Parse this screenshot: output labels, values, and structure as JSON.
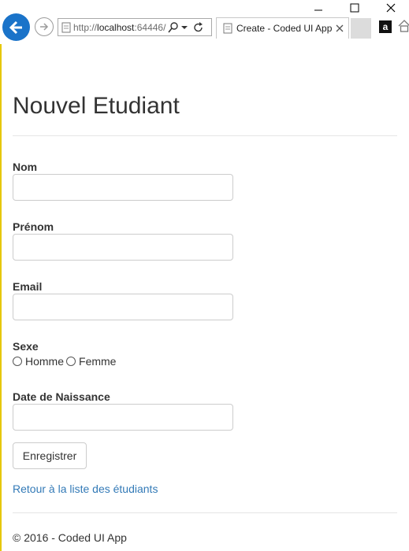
{
  "browser": {
    "url_prefix": "http://",
    "url_host": "localhost",
    "url_rest": ":64446/",
    "tab_title": "Create - Coded UI App"
  },
  "form": {
    "title": "Nouvel Etudiant",
    "nom_label": "Nom",
    "prenom_label": "Prénom",
    "email_label": "Email",
    "sexe_label": "Sexe",
    "sexe_options": [
      "Homme",
      "Femme"
    ],
    "date_label": "Date de Naissance",
    "submit_label": "Enregistrer",
    "back_link": "Retour à la liste des étudiants"
  },
  "footer": {
    "text": "© 2016 - Coded UI App"
  },
  "colors": {
    "accent_blue": "#1a73c9",
    "link": "#337ab7"
  }
}
